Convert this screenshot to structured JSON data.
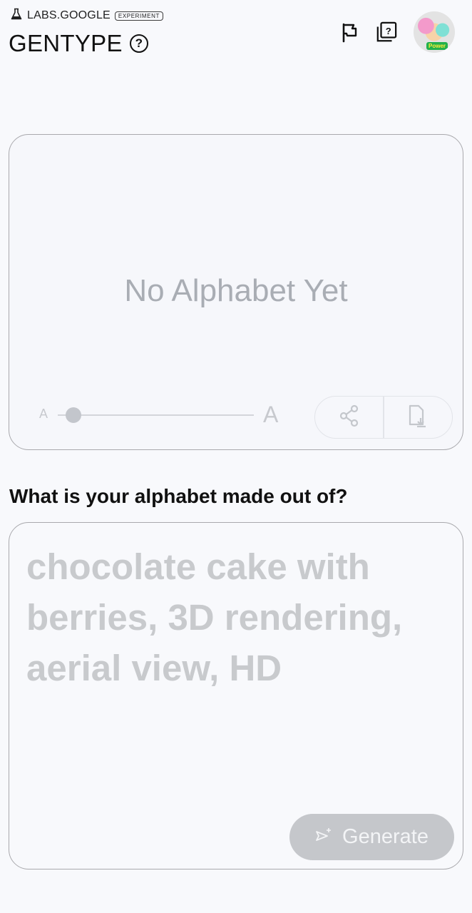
{
  "header": {
    "brand": "LABS.GOOGLE",
    "badge": "EXPERIMENT",
    "title": "GENTYPE",
    "help_glyph": "?",
    "icons": [
      "flask-icon",
      "help-circle-icon",
      "flag-icon",
      "question-stack-icon"
    ],
    "avatar_tag": "Power"
  },
  "preview": {
    "empty_message": "No Alphabet Yet",
    "size_small_label": "A",
    "size_large_label": "A",
    "size_level": 0.08,
    "actions": [
      "share-icon",
      "download-file-icon"
    ]
  },
  "prompt": {
    "question": "What is your alphabet made out of?",
    "value": "",
    "placeholder": "chocolate cake with berries, 3D rendering, aerial view, HD",
    "generate_label": "Generate",
    "generate_icon": "send-sparkle-icon"
  },
  "colors": {
    "background": "#f8f9fc",
    "card_border": "#a9a9ad",
    "muted_text": "#a9adb4",
    "button_disabled": "#c5c7cb"
  }
}
